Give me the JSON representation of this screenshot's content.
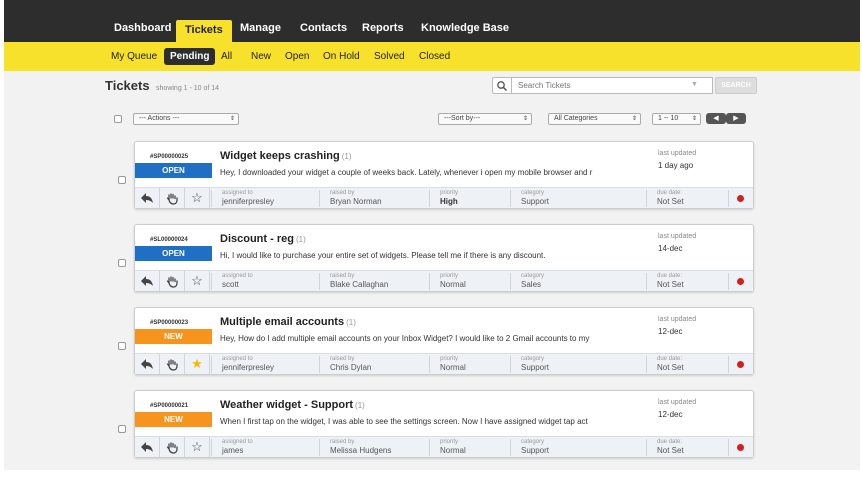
{
  "nav": {
    "items": [
      {
        "label": "Dashboard",
        "active": false
      },
      {
        "label": "Tickets",
        "active": true
      },
      {
        "label": "Manage",
        "active": false
      },
      {
        "label": "Contacts",
        "active": false
      },
      {
        "label": "Reports",
        "active": false
      },
      {
        "label": "Knowledge Base",
        "active": false
      }
    ]
  },
  "subnav": {
    "items": [
      {
        "label": "My Queue",
        "active": false
      },
      {
        "label": "Pending",
        "active": true
      },
      {
        "label": "All",
        "active": false
      },
      {
        "label": "New",
        "active": false
      },
      {
        "label": "Open",
        "active": false
      },
      {
        "label": "On Hold",
        "active": false
      },
      {
        "label": "Solved",
        "active": false
      },
      {
        "label": "Closed",
        "active": false
      }
    ]
  },
  "header": {
    "title": "Tickets",
    "subtitle": "showing 1 - 10 of 14"
  },
  "search": {
    "placeholder": "Search Tickets",
    "button_label": "SEARCH",
    "icon": "search-icon"
  },
  "toolbar": {
    "actions": "--- Actions ---",
    "sort": "---Sort by---",
    "category": "All Categories",
    "range": "1 -- 10",
    "prev_icon": "◀",
    "next_icon": "▶"
  },
  "tickets": [
    {
      "id": "#SP00000025",
      "status": "OPEN",
      "status_kind": "open",
      "subject": "Widget keeps crashing",
      "count": "(1)",
      "preview": "Hey, I downloaded your widget a couple of weeks back. Lately, whenever i open my mobile browser and r",
      "last_updated_label": "last updated",
      "last_updated": "1 day ago",
      "starred": false,
      "assigned_to_label": "assigned to",
      "assigned_to": "jenniferpresley",
      "raised_by_label": "raised by",
      "raised_by": "Bryan Norman",
      "priority_label": "priority",
      "priority": "High",
      "priority_bold": true,
      "category_label": "category",
      "category": "Support",
      "due_label": "due date:",
      "due": "Not Set"
    },
    {
      "id": "#SL00000024",
      "status": "OPEN",
      "status_kind": "open",
      "subject": "Discount - reg",
      "count": "(1)",
      "preview": "Hi, I would like to purchase your entire set of widgets. Please tell me if there is any discount.",
      "last_updated_label": "last updated",
      "last_updated": "14-dec",
      "starred": false,
      "assigned_to_label": "assigned to",
      "assigned_to": "scott",
      "raised_by_label": "raised by",
      "raised_by": "Blake Callaghan",
      "priority_label": "priority",
      "priority": "Normal",
      "priority_bold": false,
      "category_label": "category",
      "category": "Sales",
      "due_label": "due date:",
      "due": "Not Set"
    },
    {
      "id": "#SP00000023",
      "status": "NEW",
      "status_kind": "new",
      "subject": "Multiple email accounts",
      "count": "(1)",
      "preview": "Hey, How do I add multiple email accounts on your Inbox Widget? I would like to 2 Gmail accounts to my",
      "last_updated_label": "last updated",
      "last_updated": "12-dec",
      "starred": true,
      "assigned_to_label": "assigned to",
      "assigned_to": "jenniferpresley",
      "raised_by_label": "raised by",
      "raised_by": "Chris Dylan",
      "priority_label": "priority",
      "priority": "Normal",
      "priority_bold": false,
      "category_label": "category",
      "category": "Support",
      "due_label": "due date:",
      "due": "Not Set"
    },
    {
      "id": "#SP00000021",
      "status": "NEW",
      "status_kind": "new",
      "subject": "Weather widget - Support",
      "count": "(1)",
      "preview": "When I first tap on the widget, I was able to see the settings screen. Now I have assigned widget tap act",
      "last_updated_label": "last updated",
      "last_updated": "12-dec",
      "starred": false,
      "assigned_to_label": "assigned to",
      "assigned_to": "james",
      "raised_by_label": "raised by",
      "raised_by": "Melissa Hudgens",
      "priority_label": "priority",
      "priority": "Normal",
      "priority_bold": false,
      "category_label": "category",
      "category": "Support",
      "due_label": "due date:",
      "due": "Not Set"
    }
  ],
  "colors": {
    "nav_bg": "#2d2d2d",
    "accent_yellow": "#f7e12a",
    "status_open": "#1f6fc5",
    "status_new": "#f7941d",
    "due_dot": "#d21f1f"
  }
}
